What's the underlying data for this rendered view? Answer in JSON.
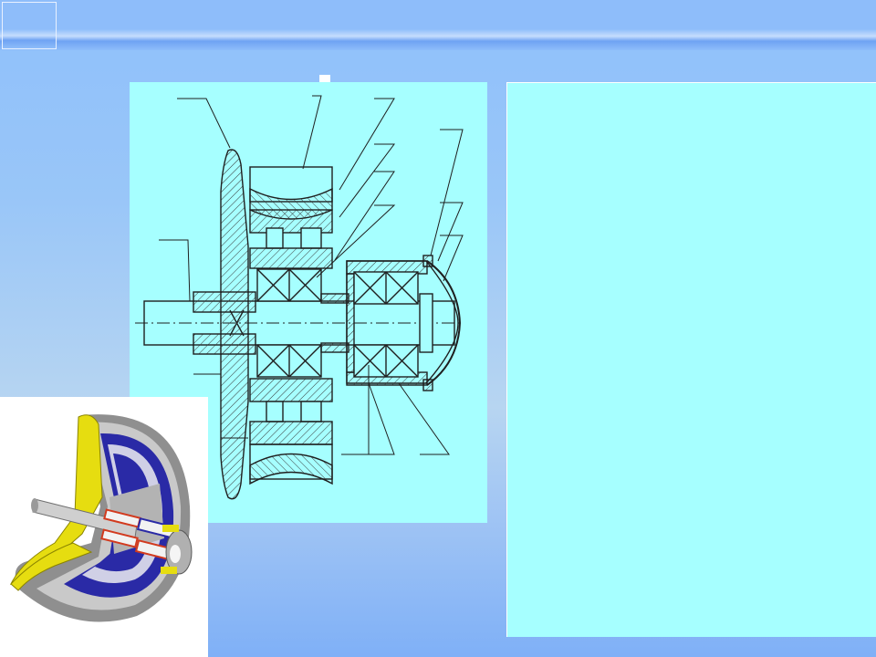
{
  "colors": {
    "background": "#99c6f8",
    "title_bar": "#8ebdfa",
    "panel": "#a6ffff",
    "line": "#1f1f1f",
    "hatch": "#3a3a3a",
    "cutaway_yellow": "#e6dd10",
    "cutaway_blue": "#2a2aa6",
    "cutaway_gray": "#9a9a9a",
    "cutaway_red": "#d23a1e"
  },
  "icons": [
    "section-drawing",
    "cutaway-rendering"
  ]
}
